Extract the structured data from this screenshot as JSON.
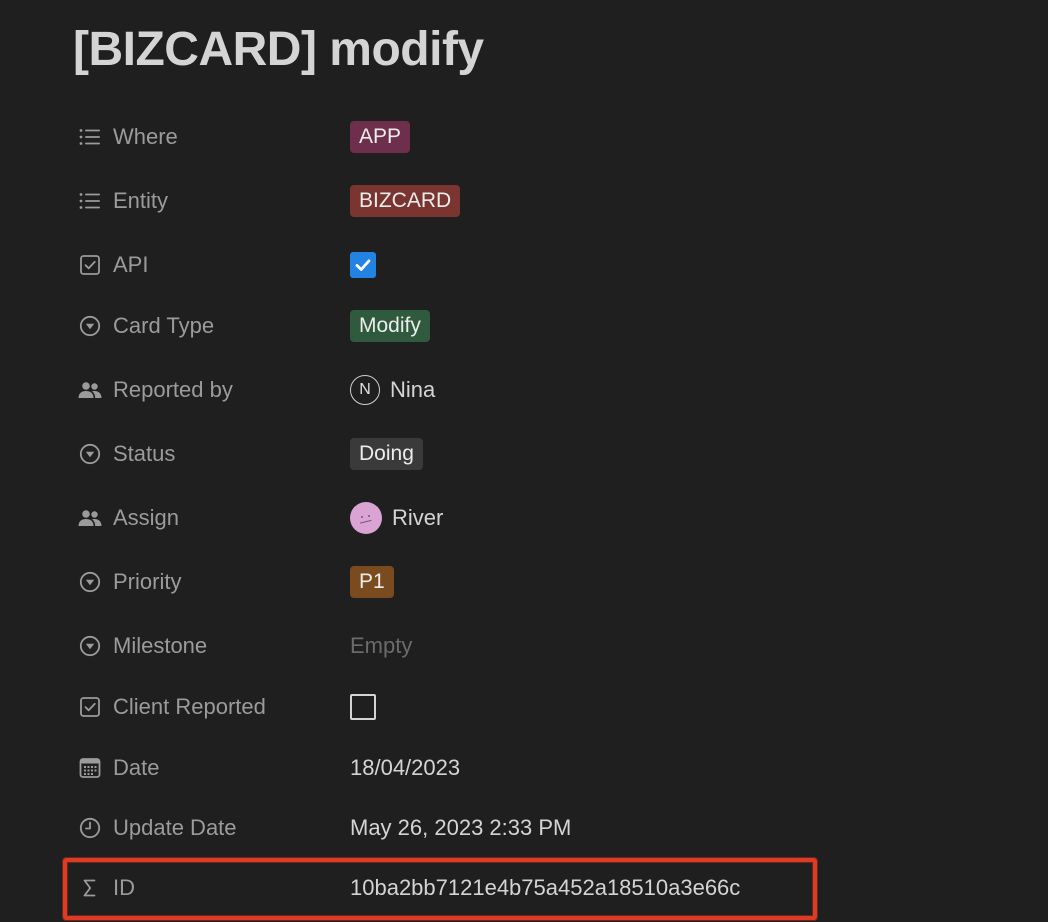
{
  "page": {
    "title": "[BIZCARD] modify"
  },
  "properties": {
    "where": {
      "name": "Where",
      "icon": "list-icon",
      "value": "APP",
      "tag_color": "#6e2f4d"
    },
    "entity": {
      "name": "Entity",
      "icon": "list-icon",
      "value": "BIZCARD",
      "tag_color": "#7a3530"
    },
    "api": {
      "name": "API",
      "icon": "checkbox-icon",
      "checked": true,
      "check_color": "#2383e2"
    },
    "card_type": {
      "name": "Card Type",
      "icon": "select-icon",
      "value": "Modify",
      "tag_color": "#2f5a3e"
    },
    "reported_by": {
      "name": "Reported by",
      "icon": "people-icon",
      "value": "Nina",
      "avatar": "N"
    },
    "status": {
      "name": "Status",
      "icon": "select-icon",
      "value": "Doing",
      "tag_color": "#3a3a3a"
    },
    "assign": {
      "name": "Assign",
      "icon": "people-icon",
      "value": "River",
      "avatar_color": "#d9a3d3"
    },
    "priority": {
      "name": "Priority",
      "icon": "select-icon",
      "value": "P1",
      "tag_color": "#7a4b1e"
    },
    "milestone": {
      "name": "Milestone",
      "icon": "select-icon",
      "value": "Empty"
    },
    "client_reported": {
      "name": "Client Reported",
      "icon": "checkbox-icon",
      "checked": false
    },
    "date": {
      "name": "Date",
      "icon": "calendar-icon",
      "value": "18/04/2023"
    },
    "update_date": {
      "name": "Update Date",
      "icon": "clock-icon",
      "value": "May 26, 2023 2:33 PM"
    },
    "id": {
      "name": "ID",
      "icon": "sigma-icon",
      "value": "10ba2bb7121e4b75a452a18510a3e66c"
    }
  },
  "annotation": {
    "highlight_color": "#e13a22"
  }
}
